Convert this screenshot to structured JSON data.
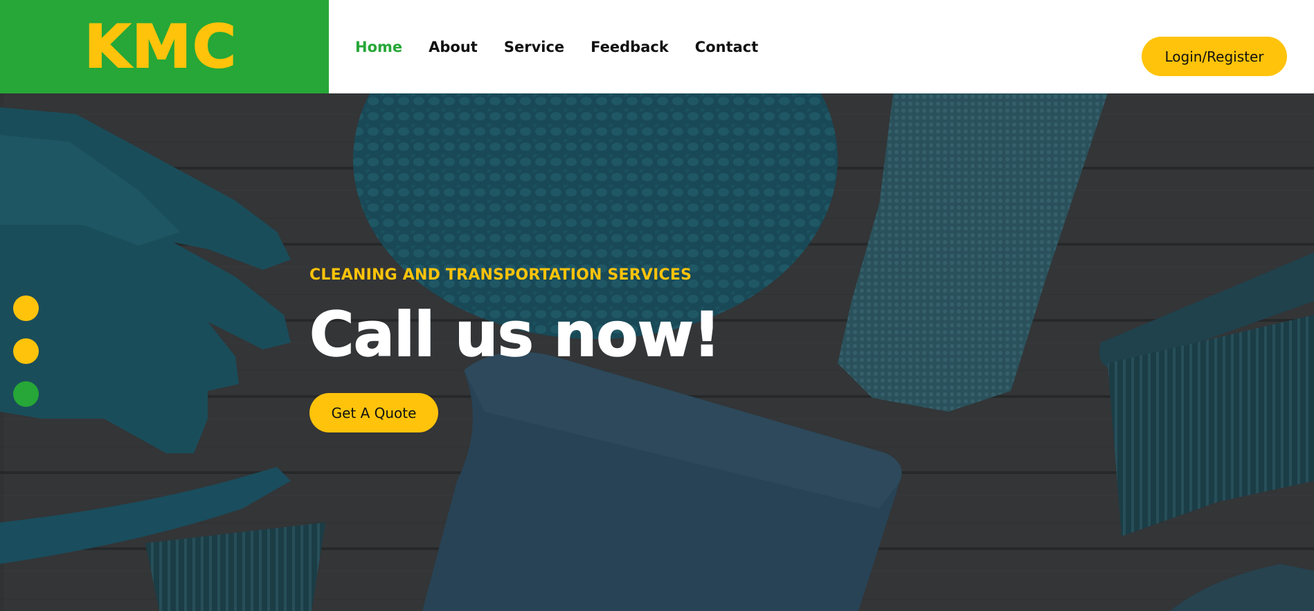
{
  "header": {
    "logo_text": "KMC",
    "nav": [
      {
        "label": "Home",
        "active": true
      },
      {
        "label": "About",
        "active": false
      },
      {
        "label": "Service",
        "active": false
      },
      {
        "label": "Feedback",
        "active": false
      },
      {
        "label": "Contact",
        "active": false
      }
    ],
    "login_label": "Login/Register"
  },
  "hero": {
    "eyebrow": "CLEANING AND TRANSPORTATION SERVICES",
    "title": "Call us now!",
    "cta_label": "Get A Quote",
    "background_image": "cleaning-supplies-photo",
    "slides": [
      {
        "state": "inactive"
      },
      {
        "state": "inactive"
      },
      {
        "state": "active"
      }
    ]
  },
  "colors": {
    "brand_green": "#26a737",
    "accent_yellow": "#ffc30b",
    "nav_text": "#111111",
    "nav_active": "#26a737",
    "hero_title": "#ffffff"
  }
}
